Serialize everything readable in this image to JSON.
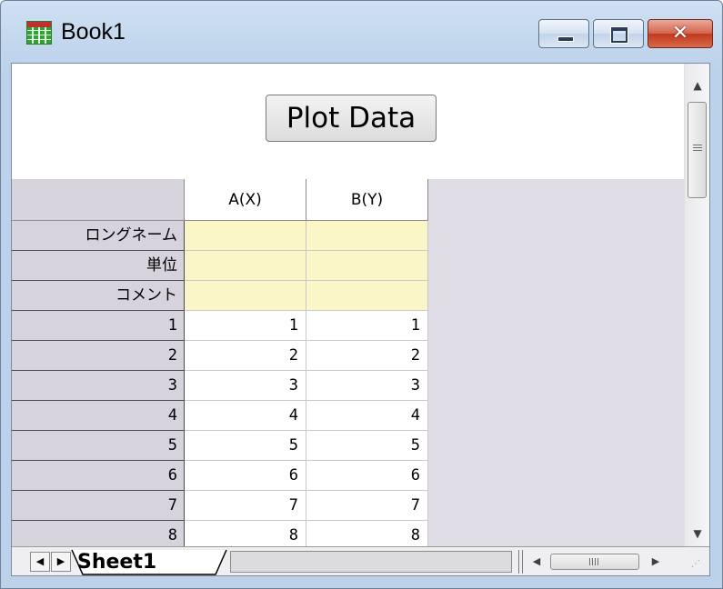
{
  "window": {
    "title": "Book1",
    "buttons": {
      "minimize": "minimize",
      "maximize": "maximize",
      "close": "✕"
    }
  },
  "header_panel": {
    "plot_button_label": "Plot Data"
  },
  "worksheet": {
    "columns": [
      "A(X)",
      "B(Y)"
    ],
    "meta_rows": [
      "ロングネーム",
      "単位",
      "コメント"
    ],
    "rows": [
      {
        "index": "1",
        "a": "1",
        "b": "1"
      },
      {
        "index": "2",
        "a": "2",
        "b": "2"
      },
      {
        "index": "3",
        "a": "3",
        "b": "3"
      },
      {
        "index": "4",
        "a": "4",
        "b": "4"
      },
      {
        "index": "5",
        "a": "5",
        "b": "5"
      },
      {
        "index": "6",
        "a": "6",
        "b": "6"
      },
      {
        "index": "7",
        "a": "7",
        "b": "7"
      },
      {
        "index": "8",
        "a": "8",
        "b": "8"
      }
    ]
  },
  "sheet_tabs": {
    "active": "Sheet1"
  },
  "scrollbar": {
    "horizontal_grip": "III",
    "vertical_grip": "≡"
  }
}
